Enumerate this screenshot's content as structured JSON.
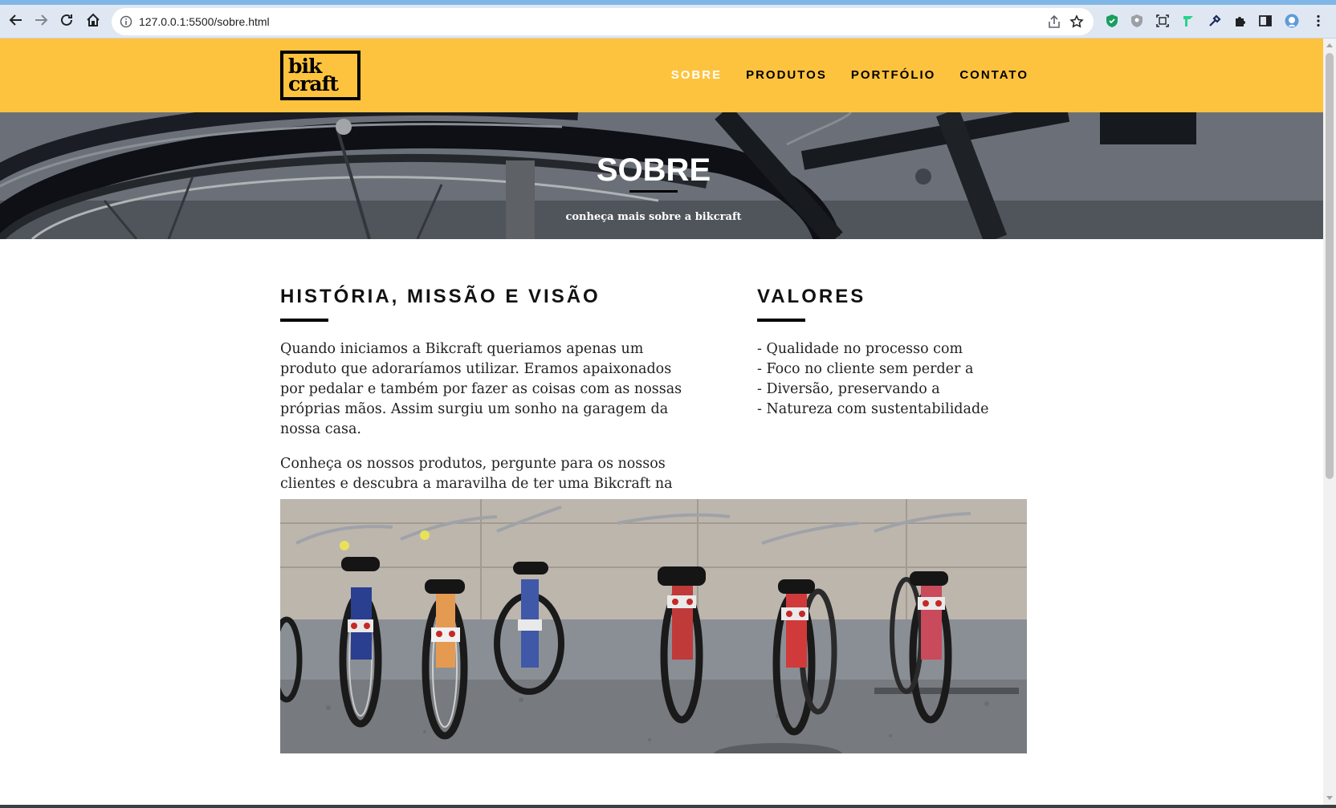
{
  "browser": {
    "url": "127.0.0.1:5500/sobre.html"
  },
  "site": {
    "logo_line1": "bik",
    "logo_line2": "craft",
    "nav": [
      {
        "label": "SOBRE",
        "active": true
      },
      {
        "label": "PRODUTOS",
        "active": false
      },
      {
        "label": "PORTFÓLIO",
        "active": false
      },
      {
        "label": "CONTATO",
        "active": false
      }
    ],
    "accent_color": "#fec33e"
  },
  "hero": {
    "title": "SOBRE",
    "subtitle": "conheça mais sobre a bikcraft"
  },
  "history": {
    "title": "HISTÓRIA, MISSÃO E VISÃO",
    "paragraph1": "Quando iniciamos a Bikcraft queriamos apenas um produto que adoraríamos utilizar. Eramos apaixonados por pedalar e também por fazer as coisas com as nossas próprias mãos. Assim surgiu um sonho na garagem da nossa casa.",
    "paragraph2": "Conheça os nossos produtos, pergunte para os nossos clientes e descubra a maravilha de ter uma Bikcraft na sua casa."
  },
  "values": {
    "title": "VALORES",
    "items": [
      "- Qualidade no processo com",
      "- Foco no cliente sem perder a",
      "- Diversão, preservando a",
      "- Natureza com sustentabilidade"
    ]
  }
}
